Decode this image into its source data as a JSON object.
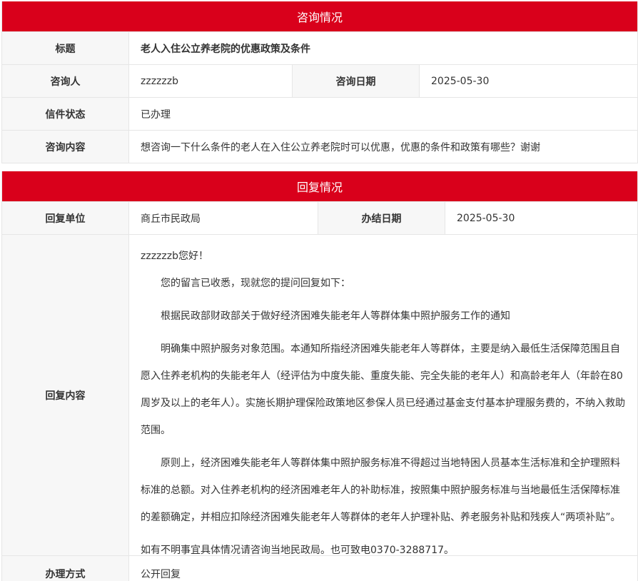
{
  "consult": {
    "header": "咨询情况",
    "title_label": "标题",
    "title_value": "老人入住公立养老院的优惠政策及条件",
    "person_label": "咨询人",
    "person_value": "zzzzzzb",
    "date_label": "咨询日期",
    "date_value": "2025-05-30",
    "status_label": "信件状态",
    "status_value": "已办理",
    "content_label": "咨询内容",
    "content_value": "想咨询一下什么条件的老人在入住公立养老院时可以优惠，优惠的条件和政策有哪些？谢谢"
  },
  "reply": {
    "header": "回复情况",
    "unit_label": "回复单位",
    "unit_value": "商丘市民政局",
    "done_date_label": "办结日期",
    "done_date_value": "2025-05-30",
    "content_label": "回复内容",
    "greeting": "zzzzzzb您好！",
    "paragraphs": [
      "您的留言已收悉，现就您的提问回复如下：",
      "根据民政部财政部关于做好经济困难失能老年人等群体集中照护服务工作的通知",
      "明确集中照护服务对象范围。本通知所指经济困难失能老年人等群体，主要是纳入最低生活保障范围且自愿入住养老机构的失能老年人（经评估为中度失能、重度失能、完全失能的老年人）和高龄老年人（年龄在80周岁及以上的老年人）。实施长期护理保险政策地区参保人员已经通过基金支付基本护理服务费的，不纳入救助范围。",
      "原则上，经济困难失能老年人等群体集中照护服务标准不得超过当地特困人员基本生活标准和全护理照料标准的总额。对入住养老机构的经济困难老年人的补助标准，按照集中照护服务标准与当地最低生活保障标准的差额确定，并相应扣除经济困难失能老年人等群体的老年人护理补贴、养老服务补贴和残疾人“两项补贴”。"
    ],
    "closing": "如有不明事宜具体情况请咨询当地民政局。也可致电0370-3288717。",
    "method_label": "办理方式",
    "method_value": "公开回复"
  }
}
